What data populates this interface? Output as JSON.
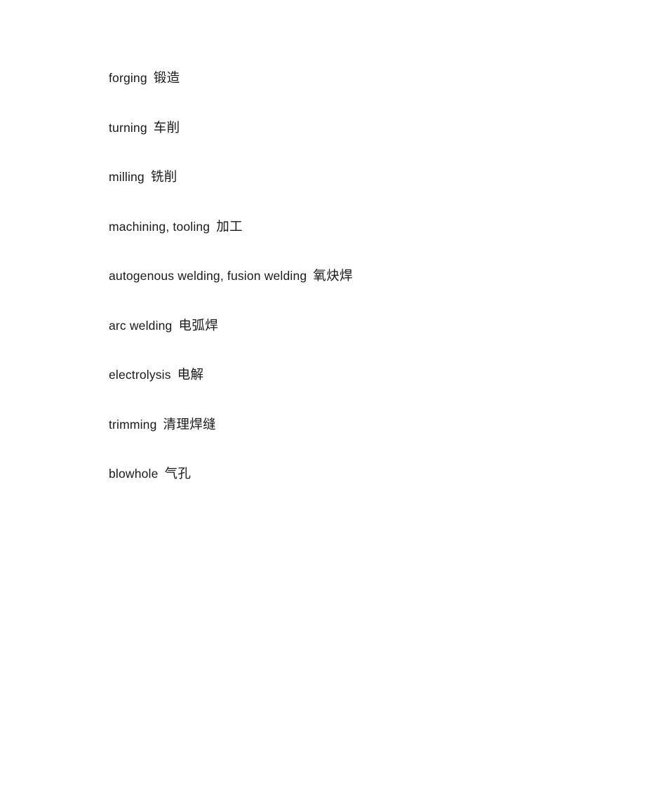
{
  "document": {
    "background_color": "#ffffff",
    "text_color": "#1a1a1a",
    "entries": [
      {
        "term": "forging",
        "gloss": "锻造"
      },
      {
        "term": "turning",
        "gloss": "车削"
      },
      {
        "term": "milling",
        "gloss": "铣削"
      },
      {
        "term": "machining, tooling",
        "gloss": "加工"
      },
      {
        "term": "autogenous welding, fusion welding",
        "gloss": "氧炔焊"
      },
      {
        "term": "arc welding",
        "gloss": "电弧焊"
      },
      {
        "term": "electrolysis",
        "gloss": "电解"
      },
      {
        "term": "trimming",
        "gloss": "清理焊缝"
      },
      {
        "term": "blowhole",
        "gloss": "气孔"
      }
    ]
  }
}
